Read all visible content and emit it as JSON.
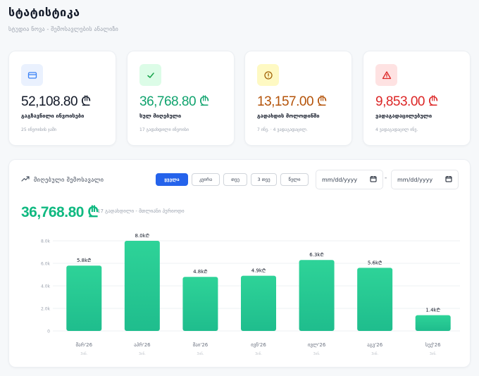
{
  "page": {
    "title": "სტატისტიკა",
    "subtitle": "სტუდია ნოვა - შემოსავლების ანალიზი"
  },
  "cards": [
    {
      "icon": "credit-card-icon",
      "value": "52,108.80 ₾",
      "label": "გაგზავნილი ინვოისები",
      "note": "25 ინვოისის ჯამი",
      "color": "#111827",
      "icon_bg": "#eaf1fe",
      "icon_color": "#3b82f6"
    },
    {
      "icon": "check-icon",
      "value": "36,768.80 ₾",
      "label": "სულ მიღებული",
      "note": "17 გადახდილი ინვოისი",
      "color": "#10a36e",
      "icon_bg": "#dcfce7",
      "icon_color": "#16a34a"
    },
    {
      "icon": "clock-icon",
      "value": "13,157.00 ₾",
      "label": "გადახდის მოლოდინში",
      "note": "7 ინვ. · 4 ვადაგადაცილ.",
      "color": "#b45309",
      "icon_bg": "#fef9c3",
      "icon_color": "#a16207"
    },
    {
      "icon": "warning-icon",
      "value": "9,853.00 ₾",
      "label": "ვადაგადაცილებული",
      "note": "4 ვადაგადაცილ ინვ.",
      "color": "#dc2626",
      "icon_bg": "#fee2e2",
      "icon_color": "#dc2626"
    }
  ],
  "panel": {
    "title": "მიღებული შემოსავალი",
    "periods": [
      "ყველა",
      "კვირა",
      "თვე",
      "3 თვე",
      "წელი"
    ],
    "active_period": "ყველა",
    "date_from_placeholder": "mm/dd/yyyy",
    "date_to_placeholder": "mm/dd/yyyy",
    "date_separator": "-",
    "total_value": "36,768.80 ₾",
    "total_note": "17 გადახდილი - მთლიანი პერიოდი"
  },
  "colors": {
    "bar_top": "#2ed398",
    "bar_bottom": "#1fbd8d",
    "accent_blue": "#2563eb",
    "accent_green": "#10b981"
  },
  "chart_data": {
    "type": "bar",
    "categories": [
      "მარ'26",
      "აპრ'26",
      "მაი'26",
      "ივნ'26",
      "ივლ'26",
      "აგვ'26",
      "სექ'26"
    ],
    "sublabels": [
      "3ინ.",
      "3ინ.",
      "3ინ.",
      "3ინ.",
      "3ინ.",
      "3ინ.",
      "3ინ."
    ],
    "values": [
      5800,
      8000,
      4800,
      4900,
      6300,
      5600,
      1400
    ],
    "value_labels": [
      "5.8k₾",
      "8.0k₾",
      "4.8k₾",
      "4.9k₾",
      "6.3k₾",
      "5.6k₾",
      "1.4k₾"
    ],
    "y_ticks": [
      0,
      2000,
      4000,
      6000,
      8000
    ],
    "y_tick_labels": [
      "0",
      "2.0k",
      "4.0k",
      "6.0k",
      "8.0k"
    ],
    "ylim": [
      0,
      8000
    ],
    "grid": true,
    "legend": "none"
  }
}
